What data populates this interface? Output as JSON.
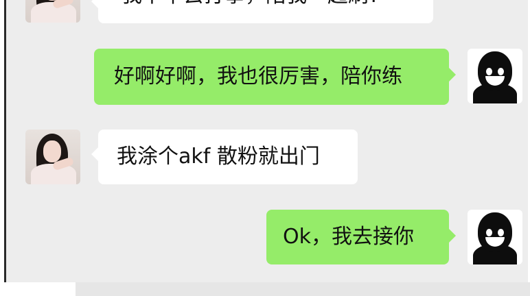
{
  "chat": {
    "messages": [
      {
        "sender": "other",
        "text": "我下午去打拳，陪我一起刷?"
      },
      {
        "sender": "self",
        "text": "好啊好啊，我也很厉害，陪你练"
      },
      {
        "sender": "other",
        "text": "我涂个akf 散粉就出门"
      },
      {
        "sender": "self",
        "text": "Ok，我去接你"
      }
    ]
  },
  "colors": {
    "chat_background": "#ededed",
    "incoming_bubble": "#ffffff",
    "outgoing_bubble": "#95ec69"
  },
  "icons": {
    "other_avatar": "girl-portrait-avatar",
    "self_avatar": "dark-smiling-shadow-avatar"
  }
}
